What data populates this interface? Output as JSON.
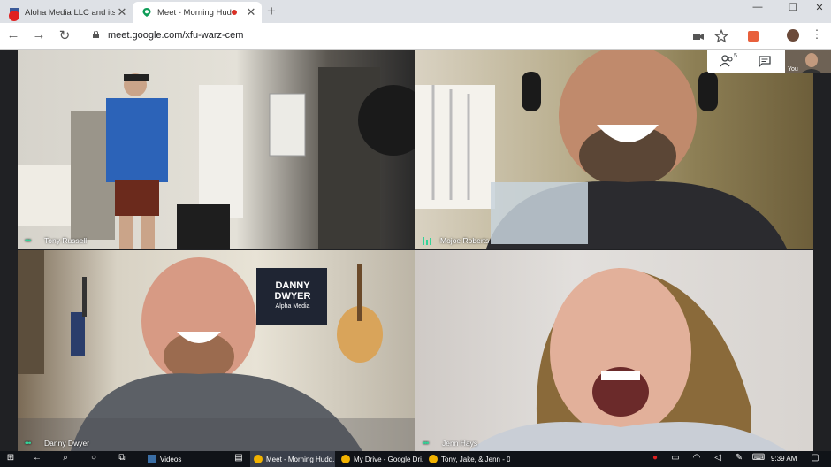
{
  "browser": {
    "tabs": [
      {
        "title": "Aloha Media LLC and its affili",
        "active": false
      },
      {
        "title": "Meet - Morning Huddle",
        "active": true
      }
    ],
    "new_tab": "+",
    "url": "meet.google.com/xfu-warz-cem"
  },
  "meet": {
    "participants_count": "5",
    "self_label": "You",
    "tiles": [
      {
        "name": "Tony Russell",
        "indicator": "dots"
      },
      {
        "name": "Mojoe Roberts",
        "indicator": "bars"
      },
      {
        "name": "Danny Dwyer",
        "indicator": "dots"
      },
      {
        "name": "Jenn Hays",
        "indicator": "dots"
      }
    ],
    "poster_text": [
      "DANNY",
      "DWYER",
      "Alpha Media"
    ]
  },
  "taskbar": {
    "items": [
      {
        "label": "Videos"
      },
      {
        "label": "Meet - Morning Hudd..."
      },
      {
        "label": "My Drive - Google Dri..."
      },
      {
        "label": "Tony, Jake, & Jenn - 0..."
      }
    ],
    "time": "9:39 AM"
  },
  "colors": {
    "speaking": "#34d399",
    "meet_bg": "#202124",
    "record": "#d93025"
  }
}
